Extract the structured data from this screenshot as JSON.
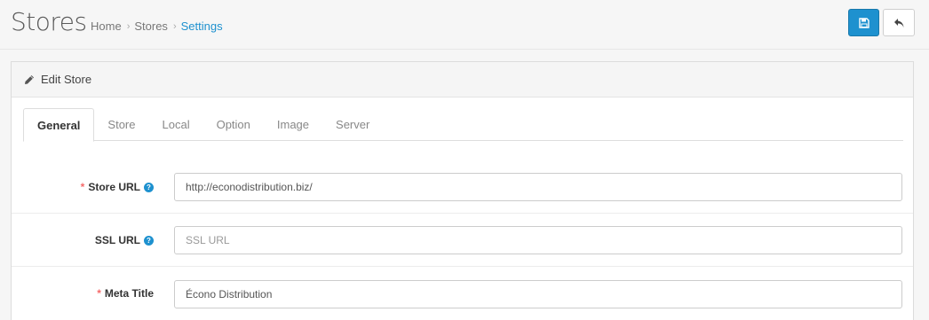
{
  "header": {
    "title": "Stores",
    "breadcrumb": [
      "Home",
      "Stores",
      "Settings"
    ],
    "save_icon": "save-icon",
    "back_icon": "reply-icon"
  },
  "panel": {
    "title": "Edit Store",
    "title_icon": "pencil-icon"
  },
  "tabs": [
    {
      "label": "General",
      "active": true
    },
    {
      "label": "Store",
      "active": false
    },
    {
      "label": "Local",
      "active": false
    },
    {
      "label": "Option",
      "active": false
    },
    {
      "label": "Image",
      "active": false
    },
    {
      "label": "Server",
      "active": false
    }
  ],
  "fields": {
    "store_url": {
      "label": "Store URL",
      "required": true,
      "help": "?",
      "value": "http://econodistribution.biz/",
      "placeholder": ""
    },
    "ssl_url": {
      "label": "SSL URL",
      "required": false,
      "help": "?",
      "value": "",
      "placeholder": "SSL URL"
    },
    "meta_title": {
      "label": "Meta Title",
      "required": true,
      "value": "Écono Distribution",
      "placeholder": ""
    }
  },
  "required_marker": "*",
  "colors": {
    "primary": "#1e91cf",
    "required": "#f56b6b"
  }
}
